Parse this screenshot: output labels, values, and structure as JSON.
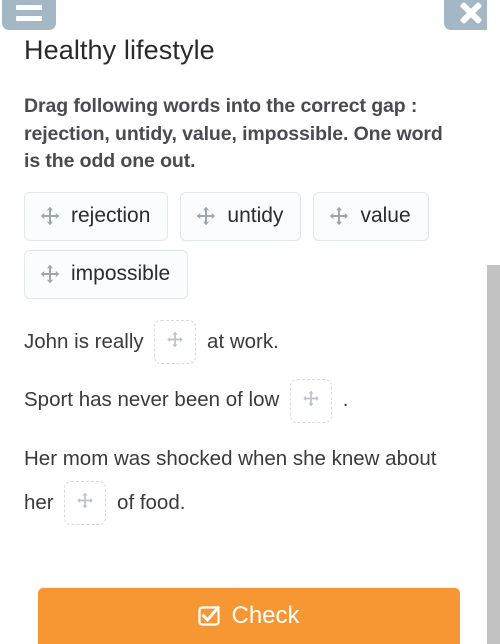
{
  "header": {
    "menu_button": {
      "icon": "hamburger-menu-icon",
      "label": ""
    },
    "close_button": {
      "icon": "close-x-icon",
      "label": ""
    },
    "bar_color": "#a3b7c4"
  },
  "page": {
    "title": "Healthy lifestyle",
    "instructions": "Drag following words into the correct gap : rejection, untidy, value, impossible. One word is the odd one out."
  },
  "word_chips": [
    {
      "label": "rejection",
      "icon": "move-arrows-icon"
    },
    {
      "label": "untidy",
      "icon": "move-arrows-icon"
    },
    {
      "label": "value",
      "icon": "move-arrows-icon"
    },
    {
      "label": "impossible",
      "icon": "move-arrows-icon"
    }
  ],
  "sentences": [
    {
      "id": "sentence-1",
      "before": "John is really",
      "gap": {
        "icon": "move-arrows-icon",
        "value": ""
      },
      "after": "at work."
    },
    {
      "id": "sentence-2",
      "before": "Sport has never been of low",
      "gap": {
        "icon": "move-arrows-icon",
        "value": ""
      },
      "after": "."
    },
    {
      "id": "sentence-3",
      "before": "Her mom was shocked when she knew about her",
      "gap": {
        "icon": "move-arrows-icon",
        "value": ""
      },
      "after": "of food."
    }
  ],
  "footer": {
    "check_button": {
      "label": "Check",
      "icon": "checkbox-checked-icon",
      "color": "#f79733"
    }
  },
  "scrollbar": {
    "thumb_color": "#c2c2c2",
    "track_color": "#ffffff"
  }
}
